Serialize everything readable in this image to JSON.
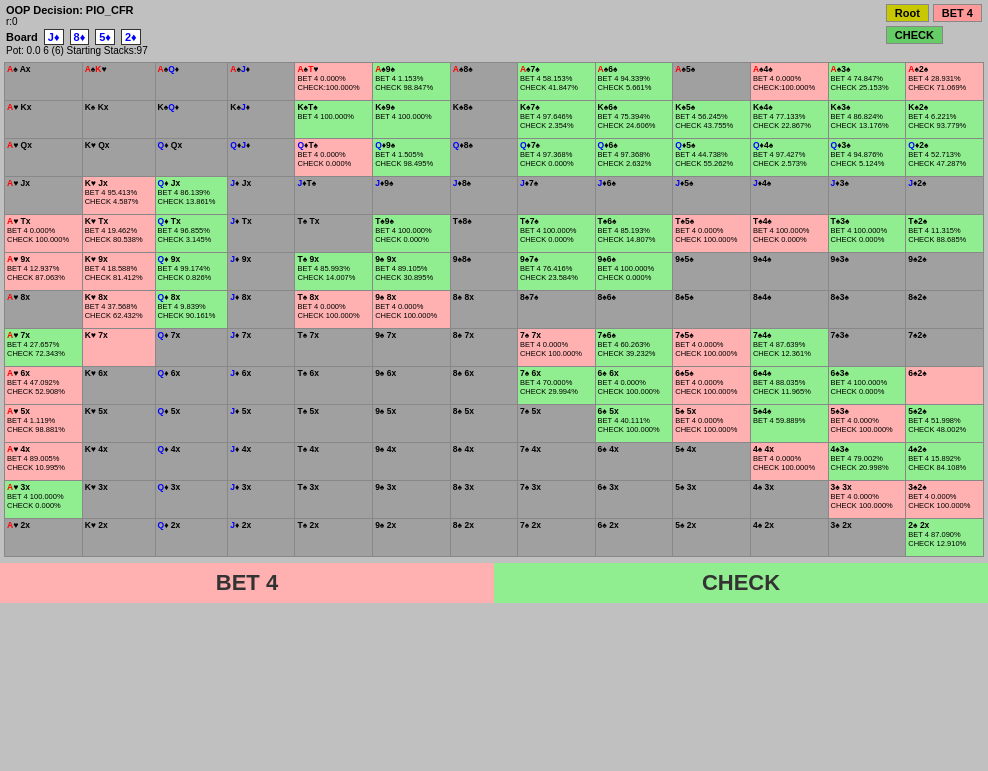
{
  "header": {
    "decision": "OOP Decision: PIO_CFR",
    "r": "r:0",
    "board_label": "Board",
    "cards": [
      "J♦",
      "8♦",
      "5♦",
      "2♦"
    ],
    "pot": "Pot: 0.0 6 (6) Starting Stacks:97",
    "btn_root": "Root",
    "btn_bet4": "BET 4",
    "btn_check": "CHECK"
  },
  "legend": {
    "bet4": "BET 4",
    "check": "CHECK"
  }
}
